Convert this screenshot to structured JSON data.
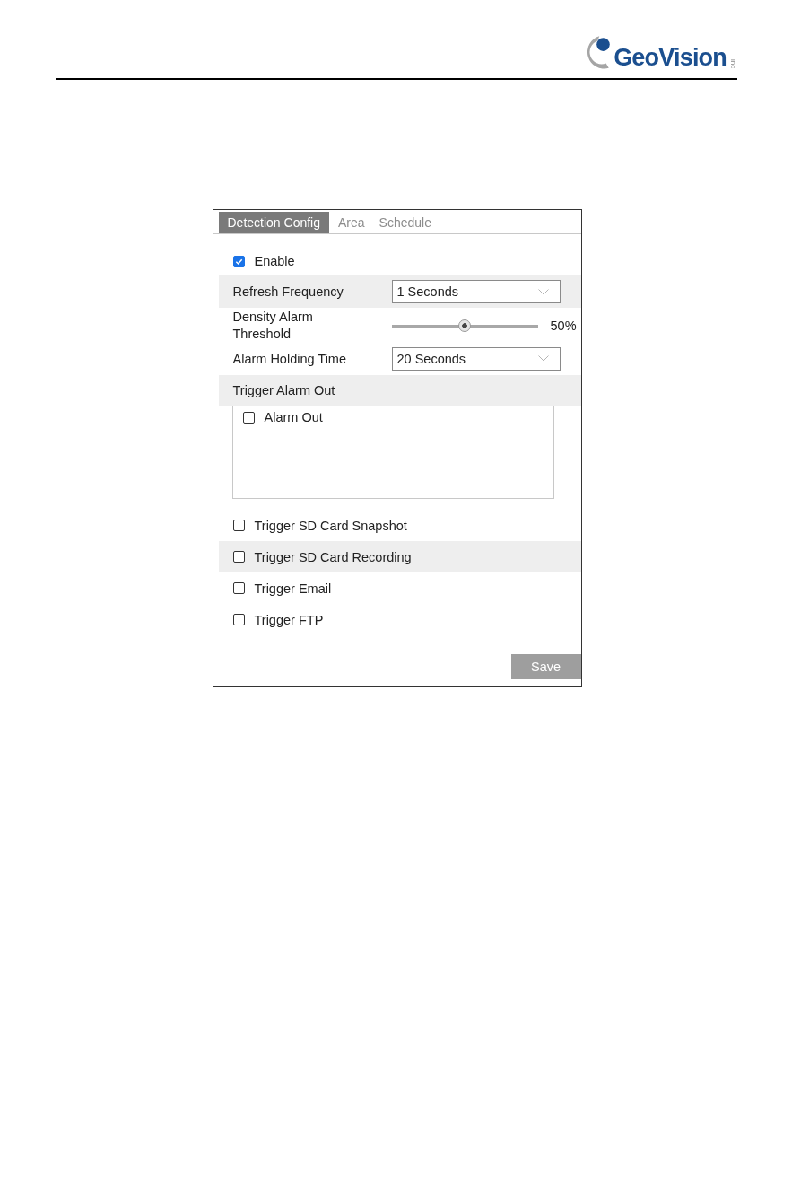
{
  "header": {
    "brand": "GeoVision",
    "brand_suffix": "inc"
  },
  "tabs": [
    {
      "label": "Detection Config",
      "selected": true
    },
    {
      "label": "Area",
      "selected": false
    },
    {
      "label": "Schedule",
      "selected": false
    }
  ],
  "settings": [
    {
      "kind": "checkbox",
      "label": "Enable",
      "checked": true,
      "shaded": false
    },
    {
      "kind": "select",
      "label": "Refresh Frequency",
      "value": "1 Seconds",
      "shaded": true
    },
    {
      "kind": "slider",
      "label": "Density Alarm Threshold",
      "level": 0.5,
      "reading": "50%",
      "shaded": false
    },
    {
      "kind": "select",
      "label": "Alarm Holding Time",
      "value": "20 Seconds",
      "shaded": false
    },
    {
      "kind": "section",
      "label": "Trigger Alarm Out",
      "shaded": true,
      "options": [
        {
          "label": "Alarm Out",
          "checked": false
        }
      ]
    },
    {
      "kind": "checkbox",
      "label": "Trigger SD Card Snapshot",
      "checked": false,
      "shaded": false
    },
    {
      "kind": "checkbox",
      "label": "Trigger SD Card Recording",
      "checked": false,
      "shaded": true
    },
    {
      "kind": "checkbox",
      "label": "Trigger Email",
      "checked": false,
      "shaded": false
    },
    {
      "kind": "checkbox",
      "label": "Trigger FTP",
      "checked": false,
      "shaded": false
    }
  ],
  "save_button": {
    "label": "Save"
  }
}
